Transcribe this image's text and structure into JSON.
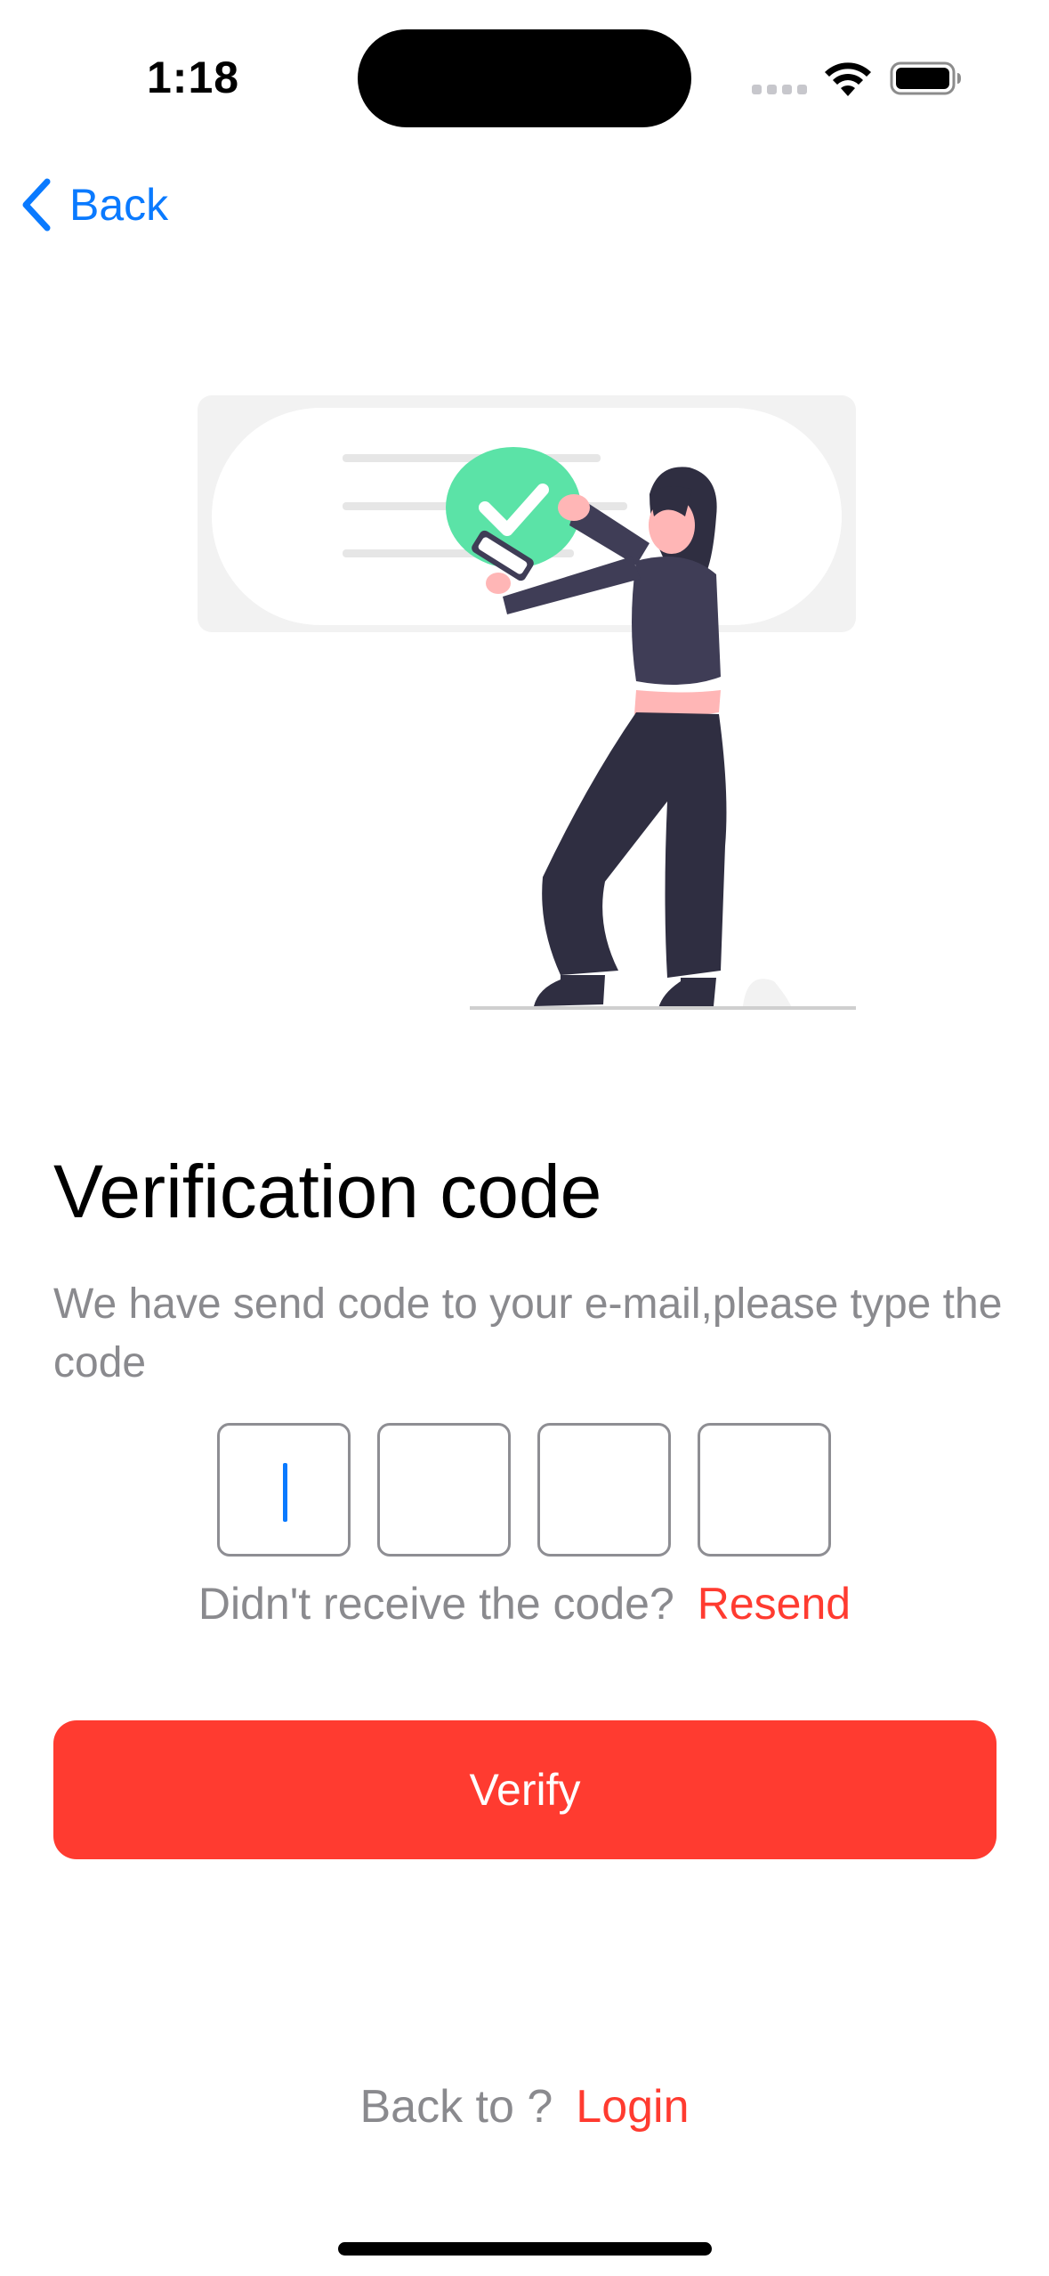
{
  "status_bar": {
    "time": "1:18"
  },
  "nav": {
    "back_label": "Back"
  },
  "content": {
    "title": "Verification code",
    "subtitle": "We have send code to your e-mail,please type the code",
    "code_digits": [
      "",
      "",
      "",
      ""
    ],
    "resend_question": "Didn't receive the code?",
    "resend_link": "Resend",
    "verify_label": "Verify"
  },
  "footer": {
    "question": "Back to ?",
    "login_link": "Login"
  },
  "colors": {
    "accent_blue": "#0a7aff",
    "primary_red": "#ff3b30",
    "secondary_text": "#8a8a8e",
    "illustration_green": "#5be3a7",
    "illustration_dark": "#3f3d56",
    "illustration_pink": "#ffb6b6"
  }
}
